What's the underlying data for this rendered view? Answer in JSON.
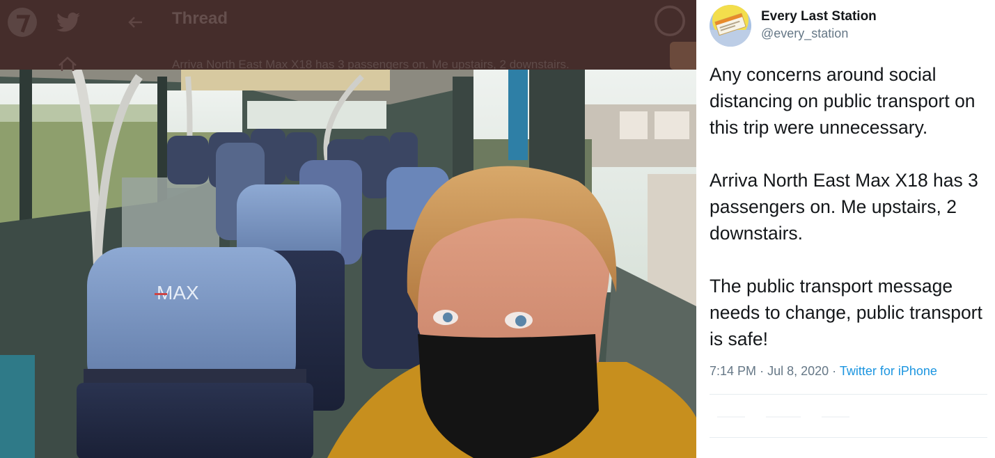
{
  "topbar": {
    "title": "Thread",
    "tweet_text_preview": "Arriva North East Max X18 has 3 passengers on. Me upstairs, 2 downstairs."
  },
  "photo": {
    "seat_brand": "MAX"
  },
  "tweet": {
    "author_name": "Every Last Station",
    "author_handle": "@every_station",
    "paragraphs": [
      "Any concerns around social distancing on public transport on this trip were unnecessary.",
      "Arriva North East Max X18 has 3 passengers on. Me upstairs, 2 downstairs.",
      "The public transport message needs to change, public transport is safe!"
    ],
    "time": "7:14 PM",
    "date": "Jul 8, 2020",
    "source": "Twitter for iPhone",
    "separator": "·"
  },
  "colors": {
    "link": "#1b95e0",
    "secondary": "#657786",
    "primary_text": "#14171a",
    "topbar_overlay": "#452c2a"
  },
  "icons": [
    "tweetdeck-logo-icon",
    "twitter-bird-icon",
    "back-arrow-icon",
    "home-icon",
    "profile-avatar-icon"
  ]
}
